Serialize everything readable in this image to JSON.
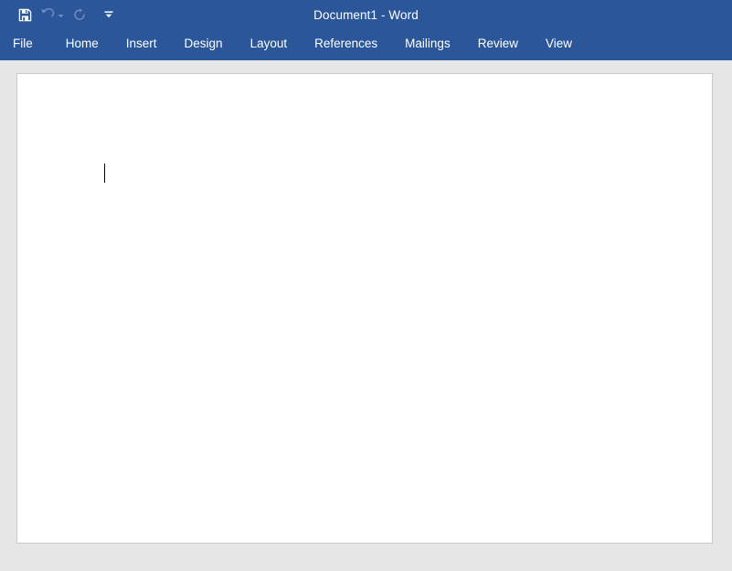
{
  "window": {
    "title": "Document1 - Word"
  },
  "quick_access_toolbar": {
    "items": [
      {
        "name": "save",
        "label": "Save",
        "icon": "save-icon",
        "enabled": true
      },
      {
        "name": "undo",
        "label": "Undo",
        "icon": "undo-icon",
        "enabled": false
      },
      {
        "name": "redo",
        "label": "Redo",
        "icon": "redo-icon",
        "enabled": false
      },
      {
        "name": "customize",
        "label": "Customize Quick Access Toolbar",
        "icon": "customize-quick-access-toolbar-icon",
        "enabled": true
      }
    ]
  },
  "ribbon": {
    "tabs": [
      {
        "label": "File",
        "active": false
      },
      {
        "label": "Home",
        "active": false
      },
      {
        "label": "Insert",
        "active": false
      },
      {
        "label": "Design",
        "active": false
      },
      {
        "label": "Layout",
        "active": false
      },
      {
        "label": "References",
        "active": false
      },
      {
        "label": "Mailings",
        "active": false
      },
      {
        "label": "Review",
        "active": false
      },
      {
        "label": "View",
        "active": false
      }
    ]
  },
  "document": {
    "body_text": "",
    "caret_visible": true
  },
  "colors": {
    "ribbon_blue": "#2b579a",
    "backdrop_gray": "#e6e6e6",
    "page_white": "#ffffff",
    "page_border": "#c9c9c9",
    "tab_text": "#ffffff",
    "caret": "#000000",
    "icon_enabled": "#ffffff",
    "icon_disabled": "#6f91c4"
  }
}
